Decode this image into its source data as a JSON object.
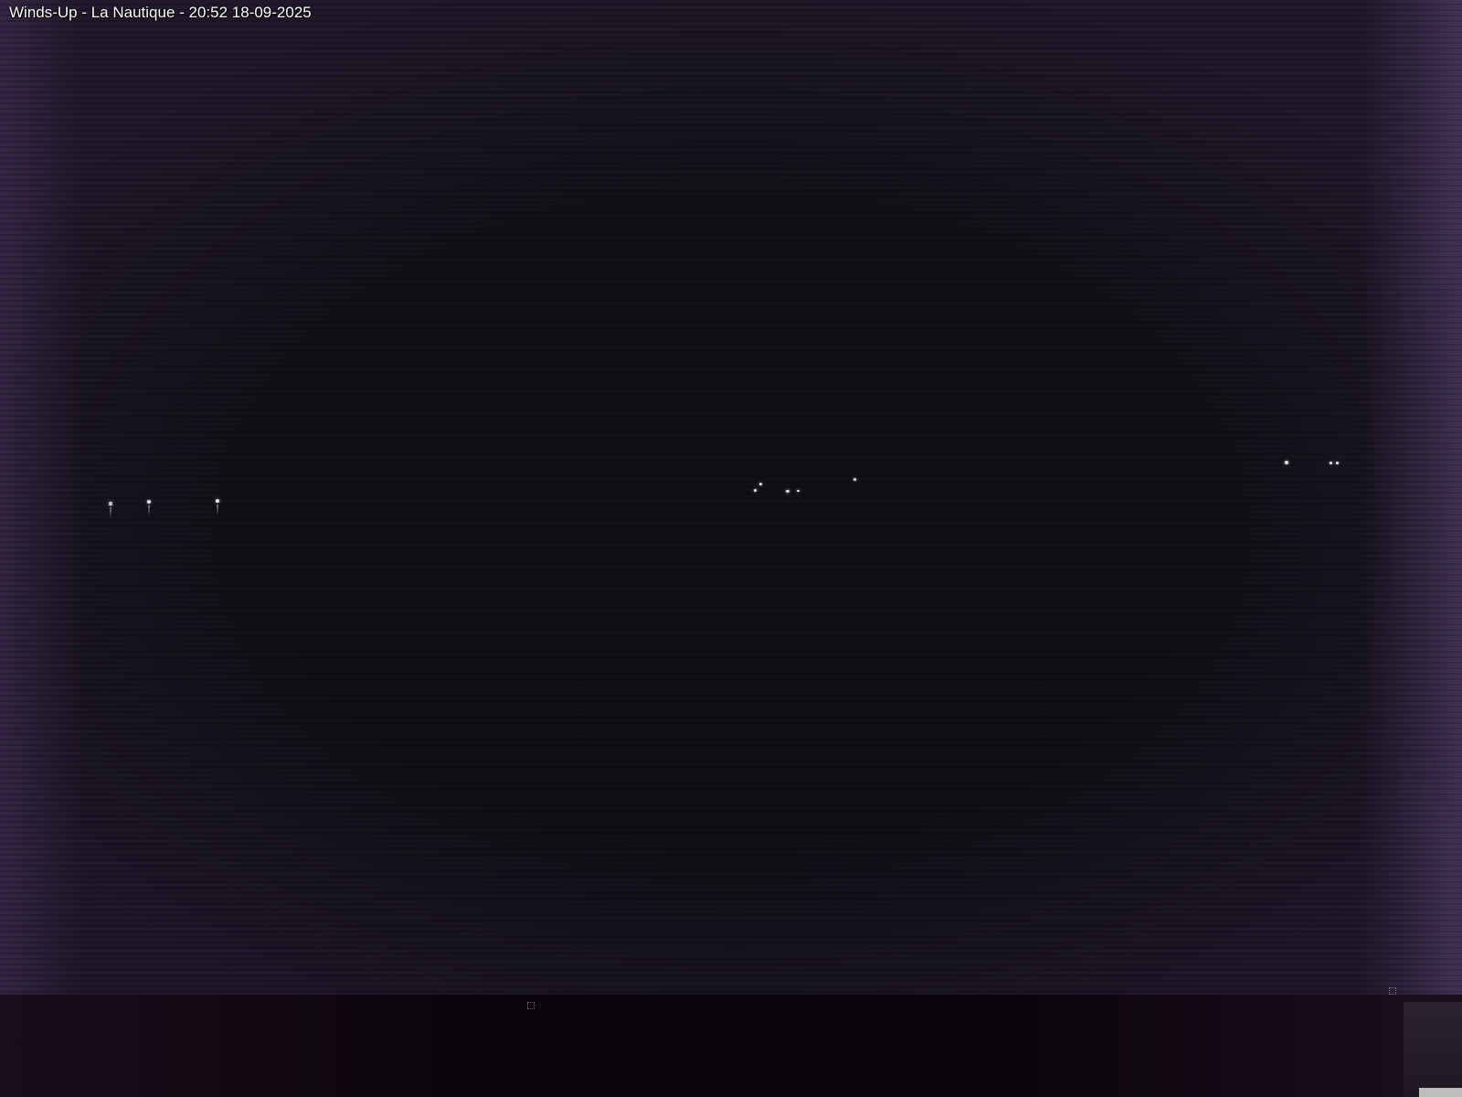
{
  "caption": {
    "text": "Winds-Up - La Nautique - 20:52 18-09-2025"
  },
  "image": {
    "subject": "night-webcam-view",
    "colors": {
      "sky": "#111016",
      "vignette": "#55416e",
      "bottom_band": "#0a040a",
      "light": "#e8e6ee",
      "caption_text": "#ffffff"
    }
  }
}
